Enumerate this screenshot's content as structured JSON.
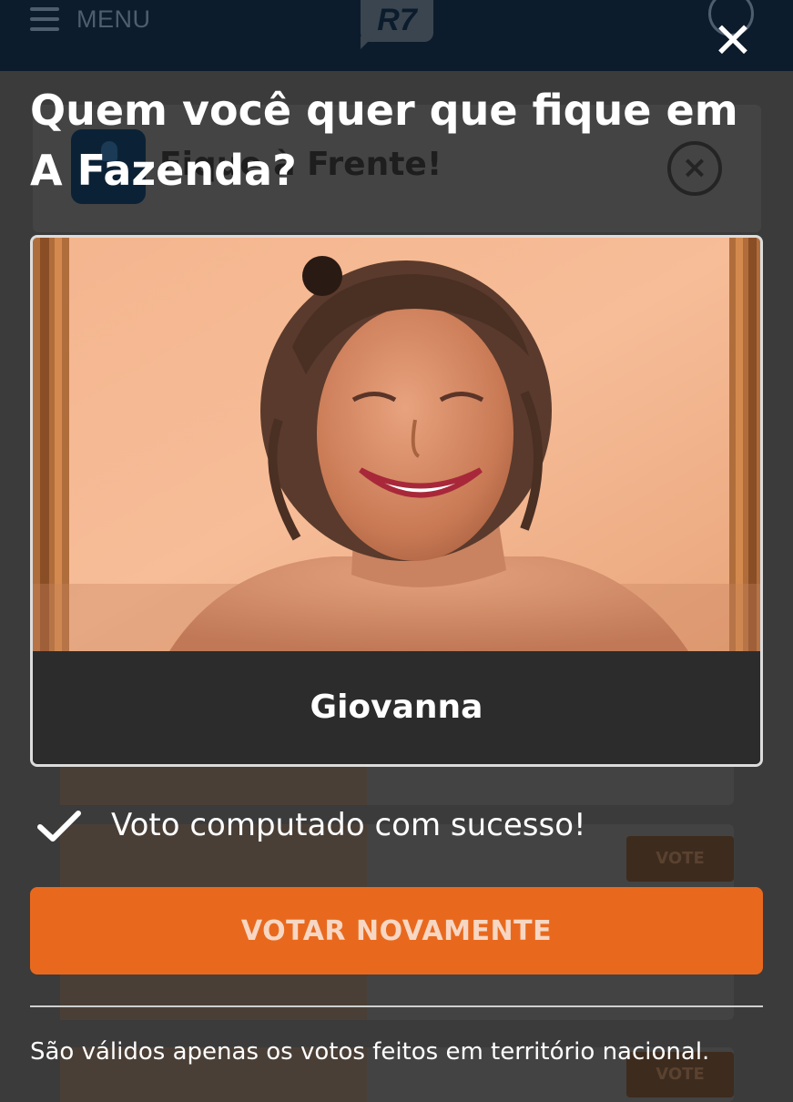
{
  "header": {
    "menu_label": "MENU",
    "logo_text": "R7"
  },
  "background": {
    "card_heading": "Fique à Frente!",
    "vote_label": "VOTE"
  },
  "modal": {
    "title": "Quem você quer que fique em A Fazenda?",
    "candidate": {
      "name": "Giovanna"
    },
    "status_message": "Voto computado com sucesso!",
    "vote_again_label": "VOTAR NOVAMENTE",
    "footnote": "São válidos apenas os votos feitos em território nacional."
  },
  "colors": {
    "header_bg": "#0c1c2c",
    "accent": "#e8691e",
    "overlay": "#3b3b3b"
  }
}
